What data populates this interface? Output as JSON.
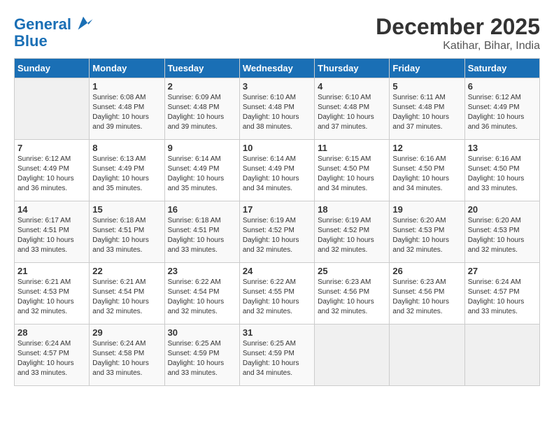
{
  "header": {
    "logo_line1": "General",
    "logo_line2": "Blue",
    "month": "December 2025",
    "location": "Katihar, Bihar, India"
  },
  "days_of_week": [
    "Sunday",
    "Monday",
    "Tuesday",
    "Wednesday",
    "Thursday",
    "Friday",
    "Saturday"
  ],
  "weeks": [
    [
      {
        "day": "",
        "sunrise": "",
        "sunset": "",
        "daylight": ""
      },
      {
        "day": "1",
        "sunrise": "Sunrise: 6:08 AM",
        "sunset": "Sunset: 4:48 PM",
        "daylight": "Daylight: 10 hours and 39 minutes."
      },
      {
        "day": "2",
        "sunrise": "Sunrise: 6:09 AM",
        "sunset": "Sunset: 4:48 PM",
        "daylight": "Daylight: 10 hours and 39 minutes."
      },
      {
        "day": "3",
        "sunrise": "Sunrise: 6:10 AM",
        "sunset": "Sunset: 4:48 PM",
        "daylight": "Daylight: 10 hours and 38 minutes."
      },
      {
        "day": "4",
        "sunrise": "Sunrise: 6:10 AM",
        "sunset": "Sunset: 4:48 PM",
        "daylight": "Daylight: 10 hours and 37 minutes."
      },
      {
        "day": "5",
        "sunrise": "Sunrise: 6:11 AM",
        "sunset": "Sunset: 4:48 PM",
        "daylight": "Daylight: 10 hours and 37 minutes."
      },
      {
        "day": "6",
        "sunrise": "Sunrise: 6:12 AM",
        "sunset": "Sunset: 4:49 PM",
        "daylight": "Daylight: 10 hours and 36 minutes."
      }
    ],
    [
      {
        "day": "7",
        "sunrise": "Sunrise: 6:12 AM",
        "sunset": "Sunset: 4:49 PM",
        "daylight": "Daylight: 10 hours and 36 minutes."
      },
      {
        "day": "8",
        "sunrise": "Sunrise: 6:13 AM",
        "sunset": "Sunset: 4:49 PM",
        "daylight": "Daylight: 10 hours and 35 minutes."
      },
      {
        "day": "9",
        "sunrise": "Sunrise: 6:14 AM",
        "sunset": "Sunset: 4:49 PM",
        "daylight": "Daylight: 10 hours and 35 minutes."
      },
      {
        "day": "10",
        "sunrise": "Sunrise: 6:14 AM",
        "sunset": "Sunset: 4:49 PM",
        "daylight": "Daylight: 10 hours and 34 minutes."
      },
      {
        "day": "11",
        "sunrise": "Sunrise: 6:15 AM",
        "sunset": "Sunset: 4:50 PM",
        "daylight": "Daylight: 10 hours and 34 minutes."
      },
      {
        "day": "12",
        "sunrise": "Sunrise: 6:16 AM",
        "sunset": "Sunset: 4:50 PM",
        "daylight": "Daylight: 10 hours and 34 minutes."
      },
      {
        "day": "13",
        "sunrise": "Sunrise: 6:16 AM",
        "sunset": "Sunset: 4:50 PM",
        "daylight": "Daylight: 10 hours and 33 minutes."
      }
    ],
    [
      {
        "day": "14",
        "sunrise": "Sunrise: 6:17 AM",
        "sunset": "Sunset: 4:51 PM",
        "daylight": "Daylight: 10 hours and 33 minutes."
      },
      {
        "day": "15",
        "sunrise": "Sunrise: 6:18 AM",
        "sunset": "Sunset: 4:51 PM",
        "daylight": "Daylight: 10 hours and 33 minutes."
      },
      {
        "day": "16",
        "sunrise": "Sunrise: 6:18 AM",
        "sunset": "Sunset: 4:51 PM",
        "daylight": "Daylight: 10 hours and 33 minutes."
      },
      {
        "day": "17",
        "sunrise": "Sunrise: 6:19 AM",
        "sunset": "Sunset: 4:52 PM",
        "daylight": "Daylight: 10 hours and 32 minutes."
      },
      {
        "day": "18",
        "sunrise": "Sunrise: 6:19 AM",
        "sunset": "Sunset: 4:52 PM",
        "daylight": "Daylight: 10 hours and 32 minutes."
      },
      {
        "day": "19",
        "sunrise": "Sunrise: 6:20 AM",
        "sunset": "Sunset: 4:53 PM",
        "daylight": "Daylight: 10 hours and 32 minutes."
      },
      {
        "day": "20",
        "sunrise": "Sunrise: 6:20 AM",
        "sunset": "Sunset: 4:53 PM",
        "daylight": "Daylight: 10 hours and 32 minutes."
      }
    ],
    [
      {
        "day": "21",
        "sunrise": "Sunrise: 6:21 AM",
        "sunset": "Sunset: 4:53 PM",
        "daylight": "Daylight: 10 hours and 32 minutes."
      },
      {
        "day": "22",
        "sunrise": "Sunrise: 6:21 AM",
        "sunset": "Sunset: 4:54 PM",
        "daylight": "Daylight: 10 hours and 32 minutes."
      },
      {
        "day": "23",
        "sunrise": "Sunrise: 6:22 AM",
        "sunset": "Sunset: 4:54 PM",
        "daylight": "Daylight: 10 hours and 32 minutes."
      },
      {
        "day": "24",
        "sunrise": "Sunrise: 6:22 AM",
        "sunset": "Sunset: 4:55 PM",
        "daylight": "Daylight: 10 hours and 32 minutes."
      },
      {
        "day": "25",
        "sunrise": "Sunrise: 6:23 AM",
        "sunset": "Sunset: 4:56 PM",
        "daylight": "Daylight: 10 hours and 32 minutes."
      },
      {
        "day": "26",
        "sunrise": "Sunrise: 6:23 AM",
        "sunset": "Sunset: 4:56 PM",
        "daylight": "Daylight: 10 hours and 32 minutes."
      },
      {
        "day": "27",
        "sunrise": "Sunrise: 6:24 AM",
        "sunset": "Sunset: 4:57 PM",
        "daylight": "Daylight: 10 hours and 33 minutes."
      }
    ],
    [
      {
        "day": "28",
        "sunrise": "Sunrise: 6:24 AM",
        "sunset": "Sunset: 4:57 PM",
        "daylight": "Daylight: 10 hours and 33 minutes."
      },
      {
        "day": "29",
        "sunrise": "Sunrise: 6:24 AM",
        "sunset": "Sunset: 4:58 PM",
        "daylight": "Daylight: 10 hours and 33 minutes."
      },
      {
        "day": "30",
        "sunrise": "Sunrise: 6:25 AM",
        "sunset": "Sunset: 4:59 PM",
        "daylight": "Daylight: 10 hours and 33 minutes."
      },
      {
        "day": "31",
        "sunrise": "Sunrise: 6:25 AM",
        "sunset": "Sunset: 4:59 PM",
        "daylight": "Daylight: 10 hours and 34 minutes."
      },
      {
        "day": "",
        "sunrise": "",
        "sunset": "",
        "daylight": ""
      },
      {
        "day": "",
        "sunrise": "",
        "sunset": "",
        "daylight": ""
      },
      {
        "day": "",
        "sunrise": "",
        "sunset": "",
        "daylight": ""
      }
    ]
  ]
}
